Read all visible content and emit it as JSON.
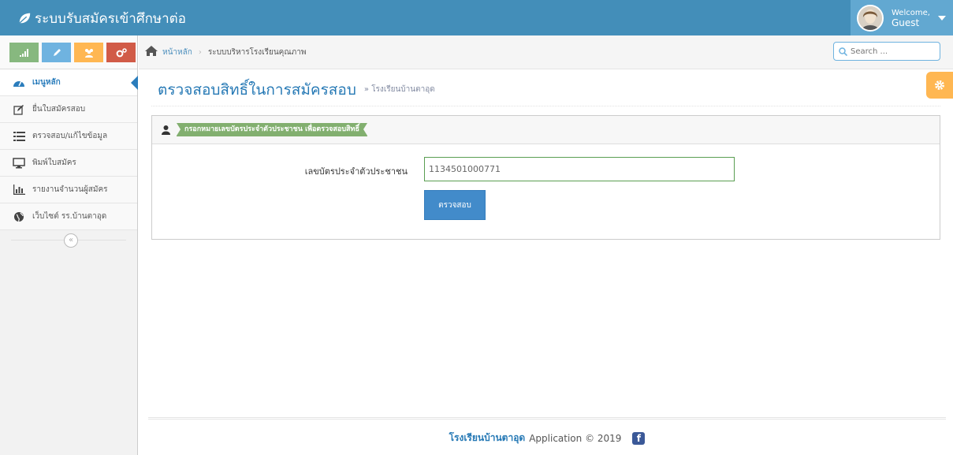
{
  "header": {
    "app_title": "ระบบรับสมัครเข้าศึกษาต่อ",
    "welcome_label": "Welcome,",
    "user_name": "Guest"
  },
  "sidebar": {
    "shortcuts": [
      {
        "icon": "signal-icon",
        "color": "#87b87f"
      },
      {
        "icon": "pencil-icon",
        "color": "#6fb3e0"
      },
      {
        "icon": "users-icon",
        "color": "#ffb752"
      },
      {
        "icon": "cogs-icon",
        "color": "#d15b47"
      }
    ],
    "items": [
      {
        "label": "เมนูหลัก",
        "icon": "tachometer-icon"
      },
      {
        "label": "ยื่นใบสมัครสอบ",
        "icon": "edit-icon"
      },
      {
        "label": "ตรวจสอบ/แก้ไขข้อมูล",
        "icon": "list-icon"
      },
      {
        "label": "พิมพ์ใบสมัคร",
        "icon": "desktop-icon"
      },
      {
        "label": "รายงานจำนวนผู้สมัคร",
        "icon": "bar-chart-icon"
      },
      {
        "label": "เว็บไซต์ รร.บ้านตาอุด",
        "icon": "globe-icon"
      }
    ],
    "collapse_symbol": "«"
  },
  "breadcrumb": {
    "home": "หน้าหลัก",
    "current": "ระบบบริหารโรงเรียนคุณภาพ"
  },
  "search": {
    "placeholder": "Search ..."
  },
  "page": {
    "title": "ตรวจสอบสิทธิ์ในการสมัครสอบ",
    "subtitle": "» โรงเรียนบ้านตาอุด"
  },
  "widget": {
    "ribbon_text": "กรอกหมายเลขบัตรประจำตัวประชาชน เพื่อตรวจสอบสิทธิ์",
    "field_label": "เลขบัตรประจำตัวประชาชน",
    "field_value": "1134501000771",
    "submit_label": "ตรวจสอบ"
  },
  "footer": {
    "school": "โรงเรียนบ้านตาอุด",
    "text": "Application © 2019",
    "facebook_icon": "f"
  },
  "colors": {
    "navbar": "#438eb9",
    "accent": "#2679b5",
    "ribbon": "#82af6f",
    "button": "#428bca",
    "settings": "#ffb752"
  }
}
